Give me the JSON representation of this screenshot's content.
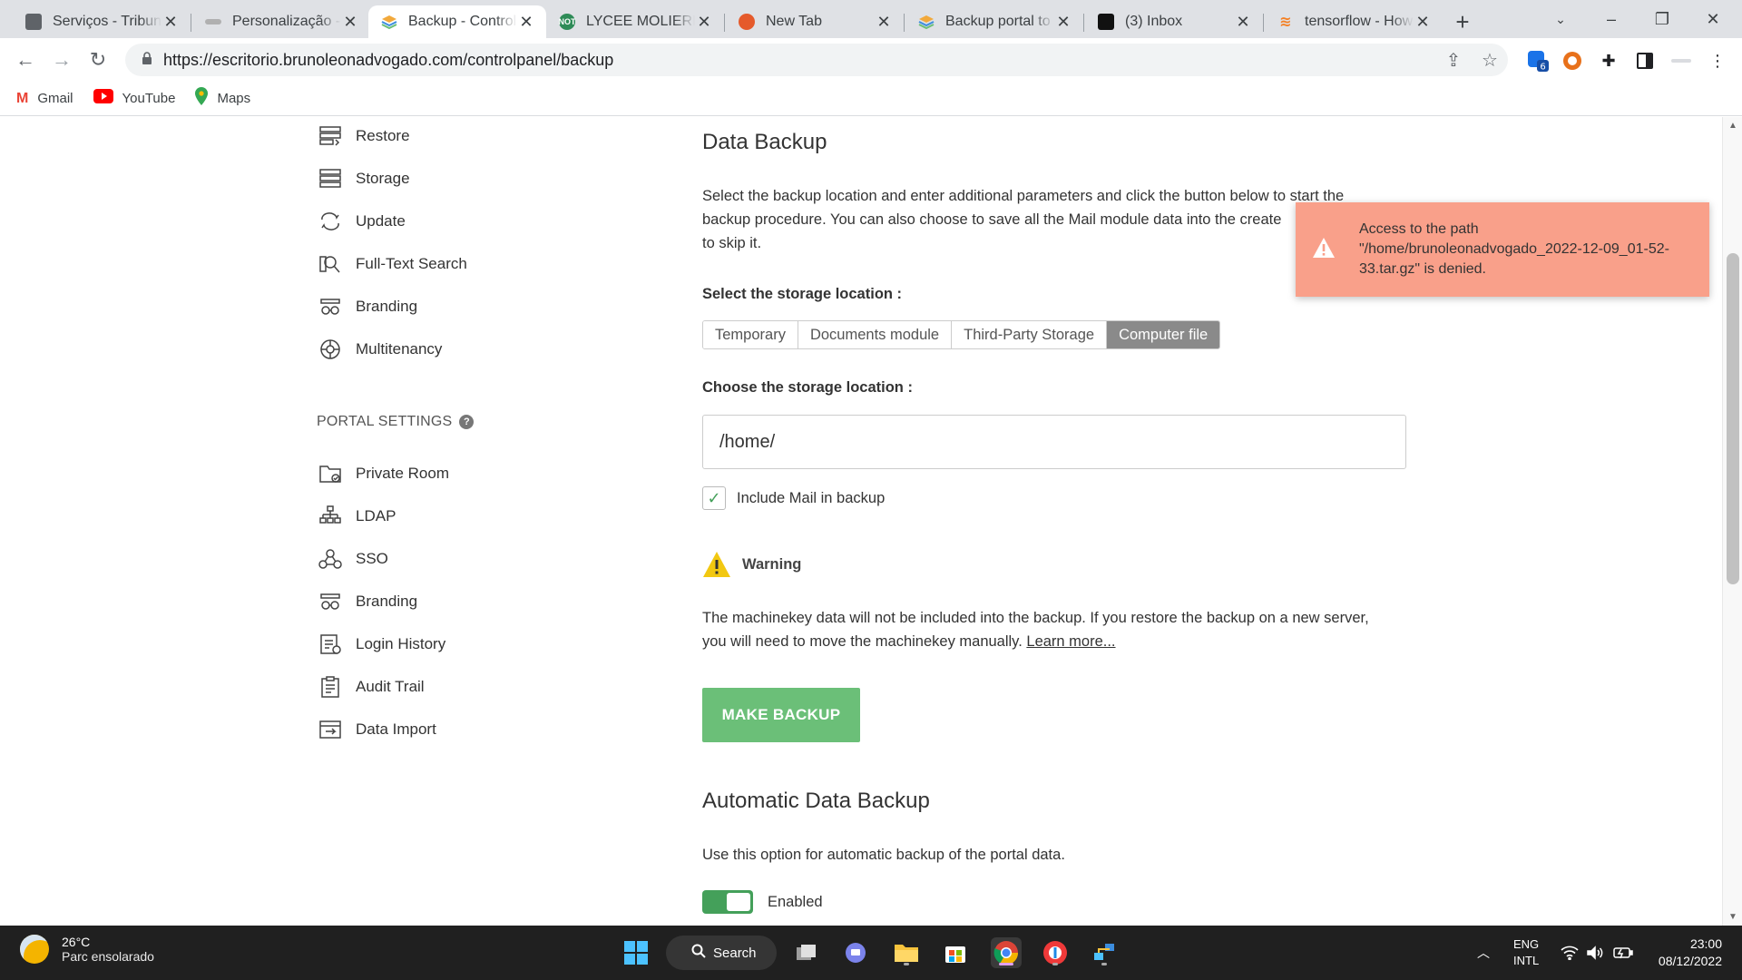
{
  "browser": {
    "tabs": [
      {
        "title": "Serviços - Tribuna",
        "favicon_color": "#5f6368",
        "active": false
      },
      {
        "title": "Personalização - E",
        "favicon_color": "#b0b0b0",
        "active": false
      },
      {
        "title": "Backup - Control",
        "favicon_color": "#3c8dde",
        "active": true
      },
      {
        "title": "LYCEE MOLIERE R",
        "favicon_color": "#2e8b57",
        "favicon_text": "NOT",
        "active": false
      },
      {
        "title": "New Tab",
        "favicon_color": "#e55a2b",
        "active": false
      },
      {
        "title": "Backup portal to",
        "favicon_color": "#3c8dde",
        "active": false
      },
      {
        "title": "(3) Inbox",
        "favicon_color": "#111111",
        "active": false
      },
      {
        "title": "tensorflow - How",
        "favicon_color": "#f48024",
        "active": false
      }
    ],
    "url": "https://escritorio.brunoleonadvogado.com/controlpanel/backup",
    "extension_badge": "6",
    "bookmarks": [
      {
        "label": "Gmail",
        "icon": "gmail-icon",
        "color": "#ea4335"
      },
      {
        "label": "YouTube",
        "icon": "youtube-icon",
        "color": "#ff0000"
      },
      {
        "label": "Maps",
        "icon": "maps-icon",
        "color": "#34a853"
      }
    ]
  },
  "sidebar": {
    "items_top": [
      {
        "label": "Restore",
        "icon": "restore-icon"
      },
      {
        "label": "Storage",
        "icon": "storage-icon"
      },
      {
        "label": "Update",
        "icon": "update-icon"
      },
      {
        "label": "Full-Text Search",
        "icon": "full-text-search-icon"
      },
      {
        "label": "Branding",
        "icon": "branding-icon"
      },
      {
        "label": "Multitenancy",
        "icon": "multitenancy-icon"
      }
    ],
    "section_title": "PORTAL SETTINGS",
    "help_glyph": "?",
    "items_portal": [
      {
        "label": "Private Room",
        "icon": "private-room-icon"
      },
      {
        "label": "LDAP",
        "icon": "ldap-icon"
      },
      {
        "label": "SSO",
        "icon": "sso-icon"
      },
      {
        "label": "Branding",
        "icon": "branding-icon"
      },
      {
        "label": "Login History",
        "icon": "login-history-icon"
      },
      {
        "label": "Audit Trail",
        "icon": "audit-trail-icon"
      },
      {
        "label": "Data Import",
        "icon": "data-import-icon"
      }
    ]
  },
  "backup": {
    "title": "Data Backup",
    "description_l1": "Select the backup location and enter additional parameters and click the button below to start the",
    "description_l2": "backup procedure. You can also choose to save all the Mail module data into the create",
    "description_l3": "to skip it.",
    "storage_location_label": "Select the storage location :",
    "storage_options": [
      "Temporary",
      "Documents module",
      "Third-Party Storage",
      "Computer file"
    ],
    "selected_option": "Computer file",
    "choose_location_label": "Choose the storage location :",
    "path_value": "/home/",
    "include_mail_label": "Include Mail in backup",
    "include_mail_checked": true,
    "warning_title": "Warning",
    "warning_text_l1": "The machinekey data will not be included into the backup. If you restore the backup on a new server,",
    "warning_text_l2": "you will need to move the machinekey manually.",
    "learn_more": "Learn more...",
    "make_backup_label": "MAKE BACKUP",
    "accent_color": "#6bbf78"
  },
  "auto_backup": {
    "title": "Automatic Data Backup",
    "description": "Use this option for automatic backup of the portal data.",
    "toggle_label": "Enabled",
    "enabled": true
  },
  "toast": {
    "line1": "Access to the path",
    "line2": "\"/home/brunoleonadvogado_2022-12-09_01-52-",
    "line3": "33.tar.gz\" is denied.",
    "color": "#f9a08a"
  },
  "taskbar": {
    "temperature": "26°C",
    "weather": "Parc ensolarado",
    "search_label": "Search",
    "lang_1": "ENG",
    "lang_2": "INTL",
    "time": "23:00",
    "date": "08/12/2022"
  }
}
